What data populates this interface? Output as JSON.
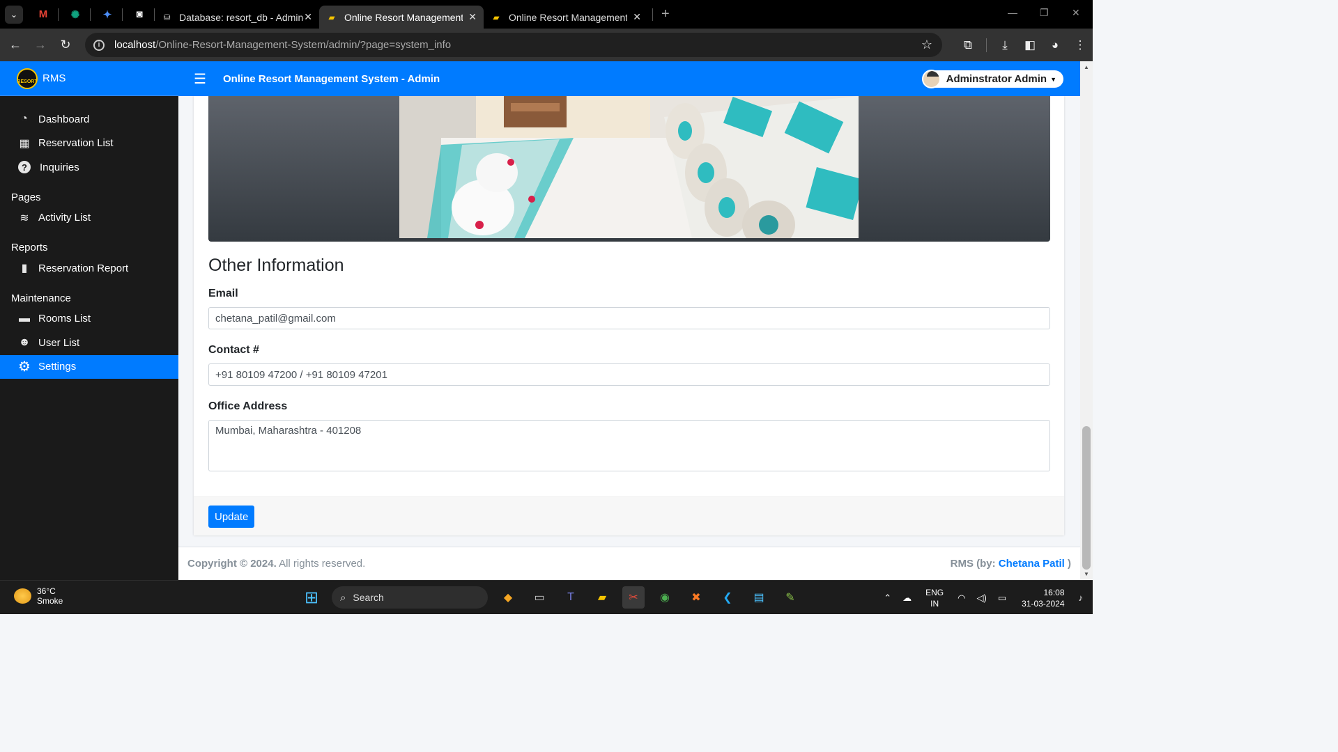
{
  "browser": {
    "tabs": [
      {
        "title": "Database: resort_db - Adminer",
        "active": false
      },
      {
        "title": "Online Resort Management Sys",
        "active": true
      },
      {
        "title": "Online Resort Management Sys",
        "active": false
      }
    ],
    "url_host": "localhost",
    "url_path": "/Online-Resort-Management-System/admin/?page=system_info"
  },
  "sidebar": {
    "brand": "RMS",
    "logo_text": "RESORT",
    "items": [
      {
        "label": "Dashboard",
        "icon": "dashboard-icon",
        "glyph": "◔"
      },
      {
        "label": "Reservation List",
        "icon": "table-icon",
        "glyph": "▦"
      },
      {
        "label": "Inquiries",
        "icon": "question-circle-icon",
        "glyph": "?"
      }
    ],
    "pages_header": "Pages",
    "pages_items": [
      {
        "label": "Activity List",
        "icon": "swimmer-icon",
        "glyph": "≋"
      }
    ],
    "reports_header": "Reports",
    "reports_items": [
      {
        "label": "Reservation Report",
        "icon": "file-icon",
        "glyph": "▮"
      }
    ],
    "maintenance_header": "Maintenance",
    "maintenance_items": [
      {
        "label": "Rooms List",
        "icon": "bed-icon",
        "glyph": "▬"
      },
      {
        "label": "User List",
        "icon": "users-icon",
        "glyph": "☻"
      },
      {
        "label": "Settings",
        "icon": "cogs-icon",
        "glyph": "⚙",
        "active": true
      }
    ]
  },
  "topnav": {
    "title": "Online Resort Management System - Admin",
    "user_name": "Adminstrator Admin"
  },
  "form": {
    "section_title": "Other Information",
    "email_label": "Email",
    "email_value": "chetana_patil@gmail.com",
    "contact_label": "Contact #",
    "contact_value": "+91 80109 47200 / +91 80109 47201",
    "address_label": "Office Address",
    "address_value": "Mumbai, Maharashtra - 401208",
    "update_button": "Update"
  },
  "footer": {
    "copyright_bold": "Copyright © 2024.",
    "copyright_rest": " All rights reserved.",
    "rms_prefix": "RMS (by: ",
    "author": "Chetana Patil",
    "rms_suffix": " )"
  },
  "taskbar": {
    "temperature": "36°C",
    "weather": "Smoke",
    "search_label": "Search",
    "lang_1": "ENG",
    "lang_2": "IN",
    "time": "16:08",
    "date": "31-03-2024"
  },
  "colors": {
    "primary": "#007bff",
    "sidebar_bg": "#1a1a1a",
    "page_bg": "#f4f6f9"
  }
}
